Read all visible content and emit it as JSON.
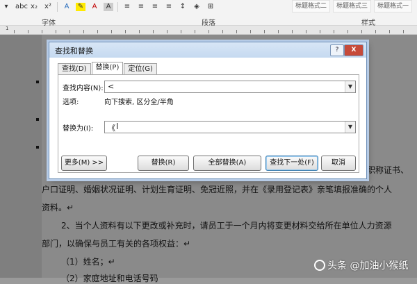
{
  "ribbon": {
    "toolbar_items": [
      "abc",
      "x₂",
      "x²",
      "A",
      "A",
      "A"
    ],
    "groups": [
      "字体",
      "段落",
      "样式"
    ],
    "style_chips": [
      "标题格式二",
      "标题格式三",
      "标题格式一"
    ]
  },
  "document": {
    "lines": [
      "职称证书、",
      "户口证明、婚姻状况证明、计划生育证明、免冠近照，并在《录用登记表》亲笔填报准确的个人",
      "资料。↵",
      "2、当个人资料有以下更改或补充时，请员工于一个月内将变更材料交给所在单位人力资源",
      "部门，以确保与员工有关的各项权益：↵",
      "（1）姓名；↵",
      "（2）家庭地址和电话号码"
    ]
  },
  "dialog": {
    "title": "查找和替换",
    "help": "?",
    "close": "X",
    "tabs": [
      "查找(D)",
      "替换(P)",
      "定位(G)"
    ],
    "find_label": "查找内容(N):",
    "find_value": "<",
    "options_label": "选项:",
    "options_value": "向下搜索, 区分全/半角",
    "replace_label": "替换为(I):",
    "replace_value": "《",
    "buttons": {
      "more": "更多(M) >>",
      "replace": "替换(R)",
      "replace_all": "全部替换(A)",
      "find_next": "查找下一处(F)",
      "cancel": "取消"
    }
  },
  "watermark": "头条 @加油小猴纸"
}
